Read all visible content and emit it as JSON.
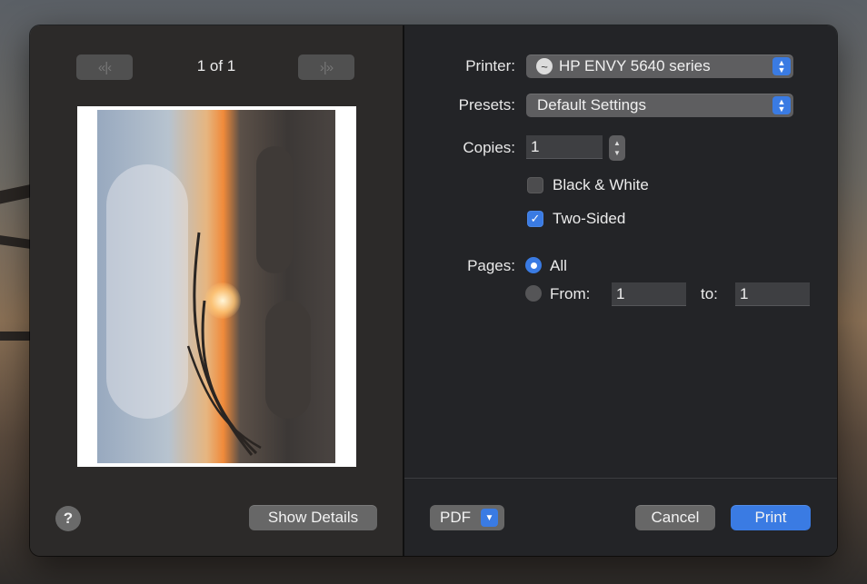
{
  "preview": {
    "page_indicator": "1 of 1",
    "nav_first_prev": "«|‹",
    "nav_next_last": "›|»",
    "help_label": "?",
    "show_details_label": "Show Details"
  },
  "settings": {
    "printer_label": "Printer:",
    "printer_value": "HP ENVY 5640 series",
    "presets_label": "Presets:",
    "presets_value": "Default Settings",
    "copies_label": "Copies:",
    "copies_value": "1",
    "black_white_label": "Black & White",
    "black_white_checked": false,
    "two_sided_label": "Two-Sided",
    "two_sided_checked": true,
    "pages_label": "Pages:",
    "pages_all_label": "All",
    "pages_from_label": "From:",
    "pages_from_value": "1",
    "pages_to_label": "to:",
    "pages_to_value": "1"
  },
  "footer": {
    "pdf_label": "PDF",
    "cancel_label": "Cancel",
    "print_label": "Print"
  },
  "colors": {
    "accent": "#3a7be3",
    "left_pane": "#2c2a29",
    "right_pane": "#232427"
  },
  "icons": {
    "printer": "printer-icon",
    "popup_arrows": "up-down-chevron-icon",
    "checkmark": "checkmark-icon"
  }
}
